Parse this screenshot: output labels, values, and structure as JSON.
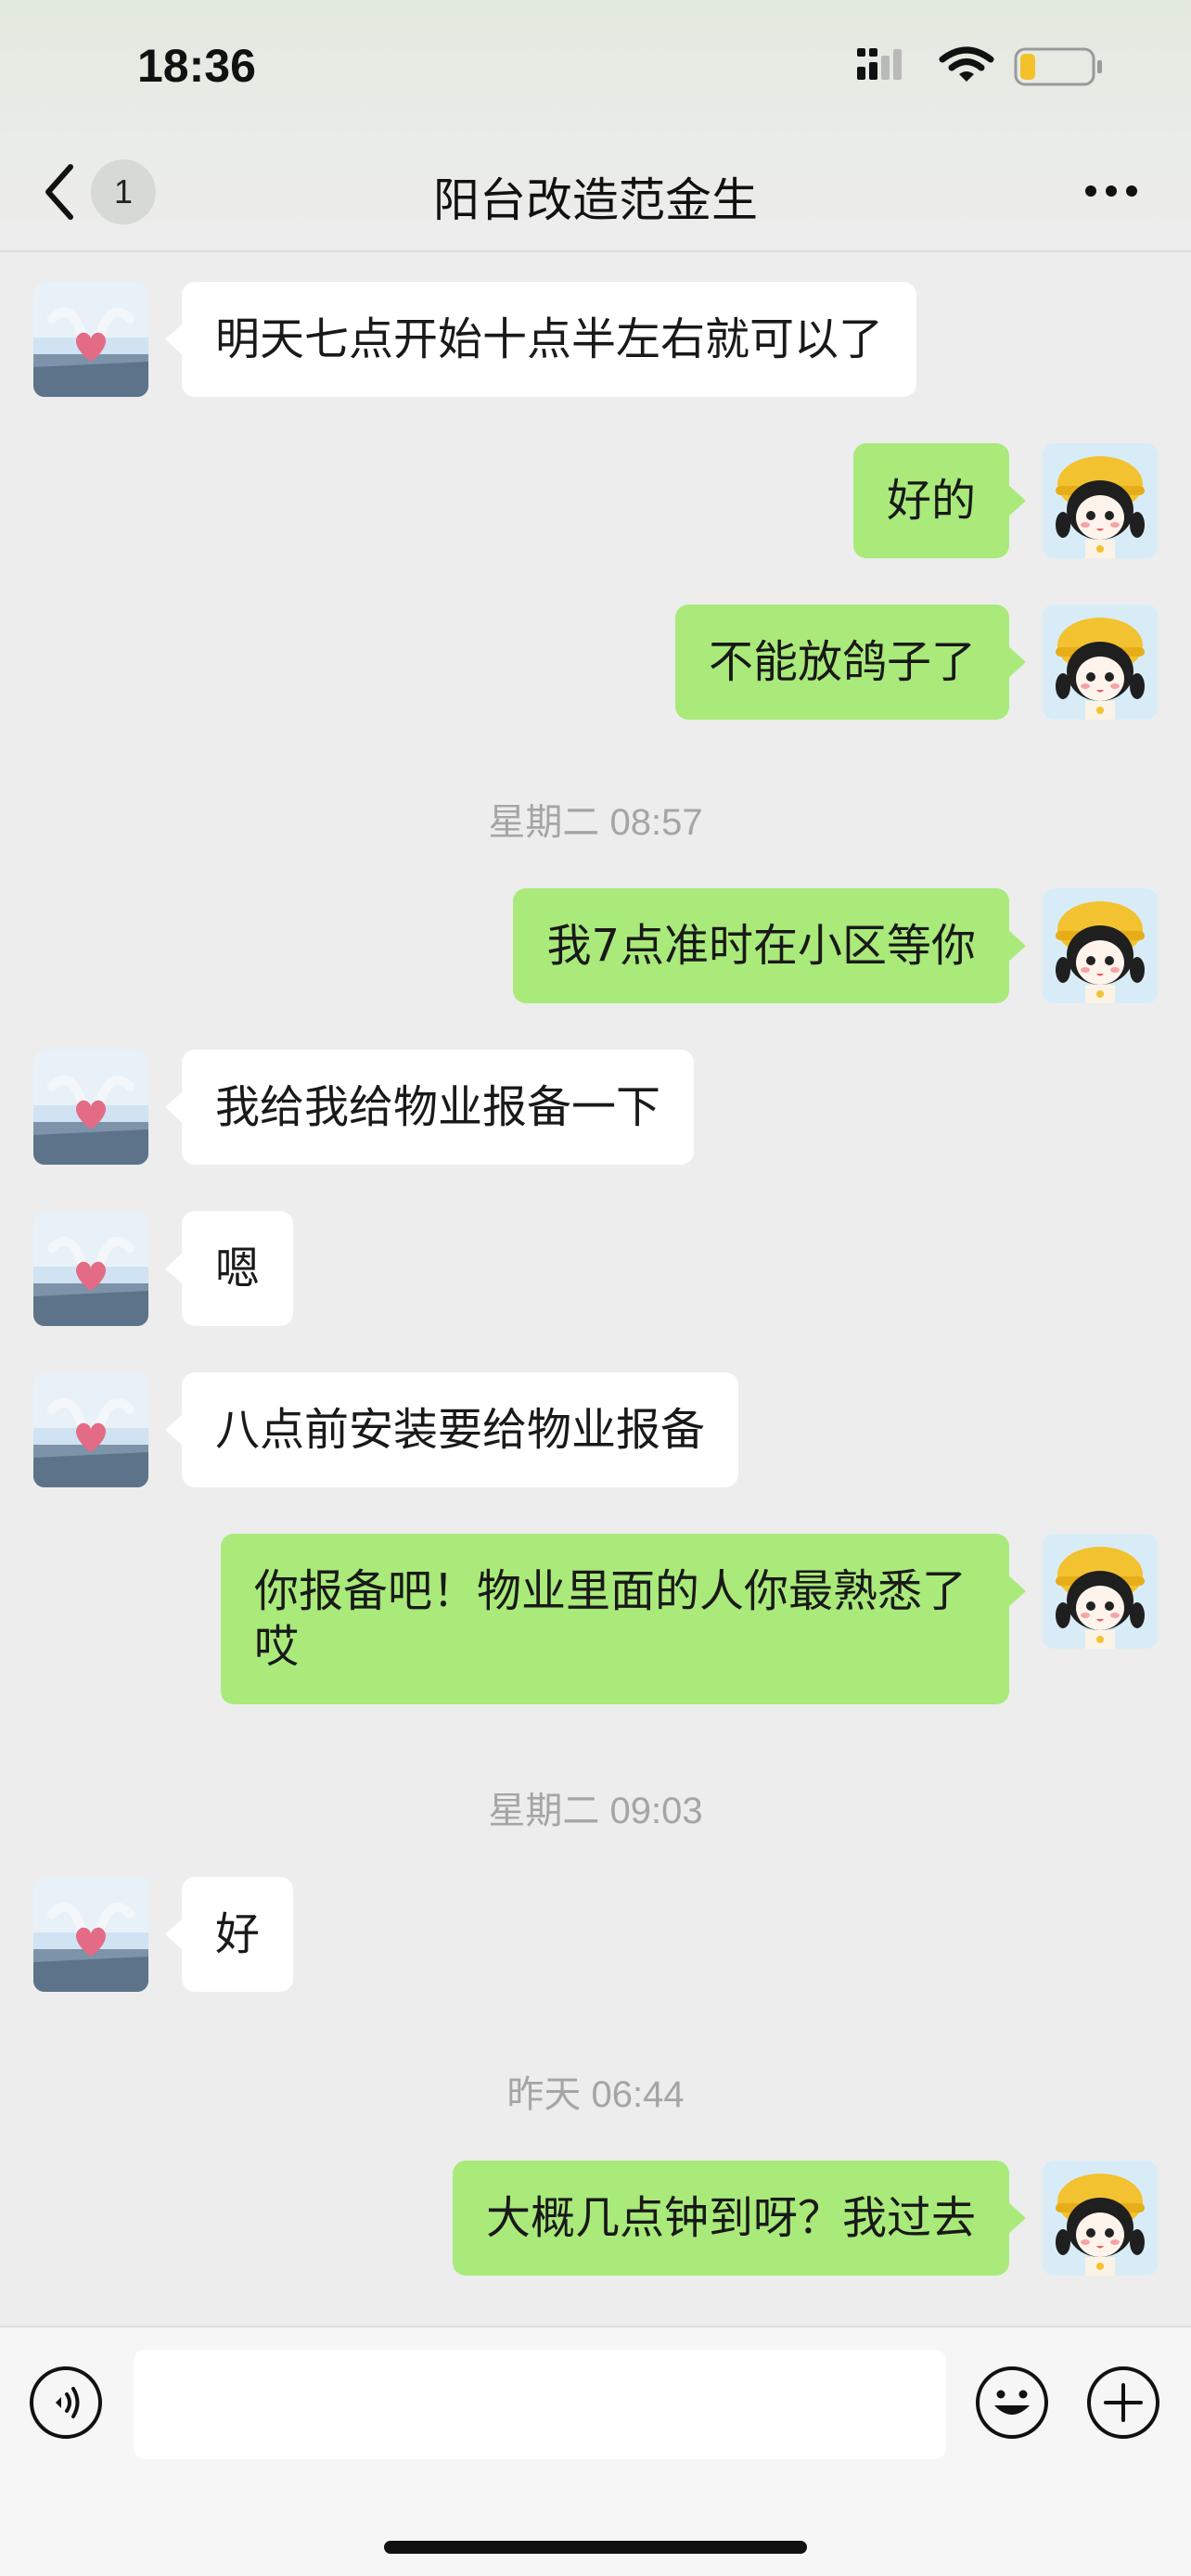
{
  "status_bar": {
    "time": "18:36"
  },
  "nav": {
    "back_count": "1",
    "title": "阳台改造范金生"
  },
  "messages": [
    {
      "text": "明天七点开始十点半左右就可以了"
    },
    {
      "text": "好的"
    },
    {
      "text": "不能放鸽子了"
    },
    {
      "text": "星期二 08:57"
    },
    {
      "text": "我7点准时在小区等你"
    },
    {
      "text": "我给我给物业报备一下"
    },
    {
      "text": "嗯"
    },
    {
      "text": "八点前安装要给物业报备"
    },
    {
      "text": "你报备吧！物业里面的人你最熟悉了哎"
    },
    {
      "text": "星期二 09:03"
    },
    {
      "text": "好"
    },
    {
      "text": "昨天 06:44"
    },
    {
      "text": "大概几点钟到呀？我过去"
    }
  ],
  "input": {
    "value": ""
  },
  "colors": {
    "background": "#ededed",
    "sent_bubble": "#a9ea7a",
    "received_bubble": "#ffffff"
  },
  "icons": [
    "back-chevron-icon",
    "more-icon",
    "voice-icon",
    "emoji-icon",
    "plus-icon",
    "signal-icon",
    "wifi-icon",
    "battery-icon"
  ]
}
